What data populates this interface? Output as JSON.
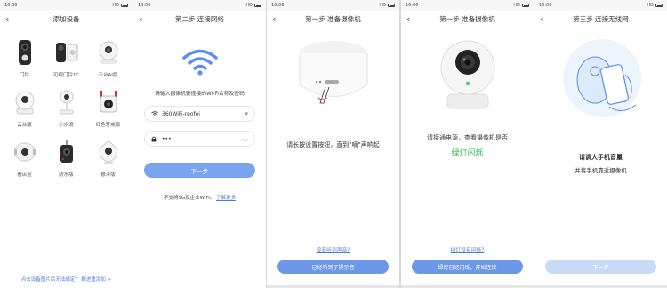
{
  "status": {
    "time": "16:06",
    "icons": "2s 3d 3d",
    "right": "HD"
  },
  "screen1": {
    "title": "添加设备",
    "devices": [
      {
        "label": "门铃",
        "icon": "doorbell-icon"
      },
      {
        "label": "可视门铃1C",
        "icon": "video-doorbell-icon"
      },
      {
        "label": "云台AI版",
        "icon": "ptz-camera-ai-icon"
      },
      {
        "label": "云台版",
        "icon": "ptz-camera-icon"
      },
      {
        "label": "小水滴",
        "icon": "small-drop-camera-icon"
      },
      {
        "label": "红色警戒版",
        "icon": "red-alert-camera-icon"
      },
      {
        "label": "看店宝",
        "icon": "store-camera-icon"
      },
      {
        "label": "防水版",
        "icon": "waterproof-camera-icon"
      },
      {
        "label": "悬浮版",
        "icon": "floating-camera-icon"
      }
    ],
    "footer": "点击设备图片后无法绑定？ 歇进重添加 >"
  },
  "screen2": {
    "title": "第二步 连接网络",
    "hint": "请输入摄像机要连接的Wi-Fi名称及密码",
    "ssid": "360WiFi-reofei",
    "password": "•••",
    "next": "下一步",
    "note_text": "不支持5G及企业WiFi。",
    "note_link": "了解更多"
  },
  "screen3": {
    "title": "第一步 准备摄像机",
    "caption": "请长按设置按钮，直到\"嘀\"声响起",
    "link": "没有听到声音?",
    "button": "已经听到了提示音"
  },
  "screen4": {
    "title": "第一步 准备摄像机",
    "caption": "请接通电源，查看摄像机是否",
    "highlight": "绿灯闪烁",
    "link": "绿灯没有闪烁?",
    "button": "绿灯已经闪烁，开始连接"
  },
  "screen5": {
    "title": "第三步 连接无线网",
    "caption1": "请调大手机音量",
    "caption2": "并将手机靠近摄像机",
    "button": "下一步"
  },
  "colors": {
    "accent": "#6d98ea",
    "green": "#2fbf4f",
    "link": "#4a7fd6"
  }
}
